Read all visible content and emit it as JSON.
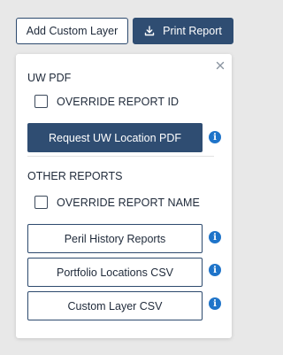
{
  "toolbar": {
    "add_custom_layer": "Add Custom Layer",
    "print_report": "Print Report"
  },
  "panel": {
    "uw_pdf": {
      "title": "UW PDF",
      "override_label": "OVERRIDE REPORT ID",
      "request_button": "Request UW Location PDF"
    },
    "other_reports": {
      "title": "OTHER REPORTS",
      "override_label": "OVERRIDE REPORT NAME",
      "buttons": [
        "Peril History Reports",
        "Portfolio Locations CSV",
        "Custom Layer CSV"
      ]
    },
    "info_glyph": "i"
  },
  "colors": {
    "primary": "#2f4d72",
    "info": "#1f74c9",
    "background": "#e8e8e8"
  },
  "icons": [
    "download-icon",
    "close-icon",
    "info-icon"
  ]
}
